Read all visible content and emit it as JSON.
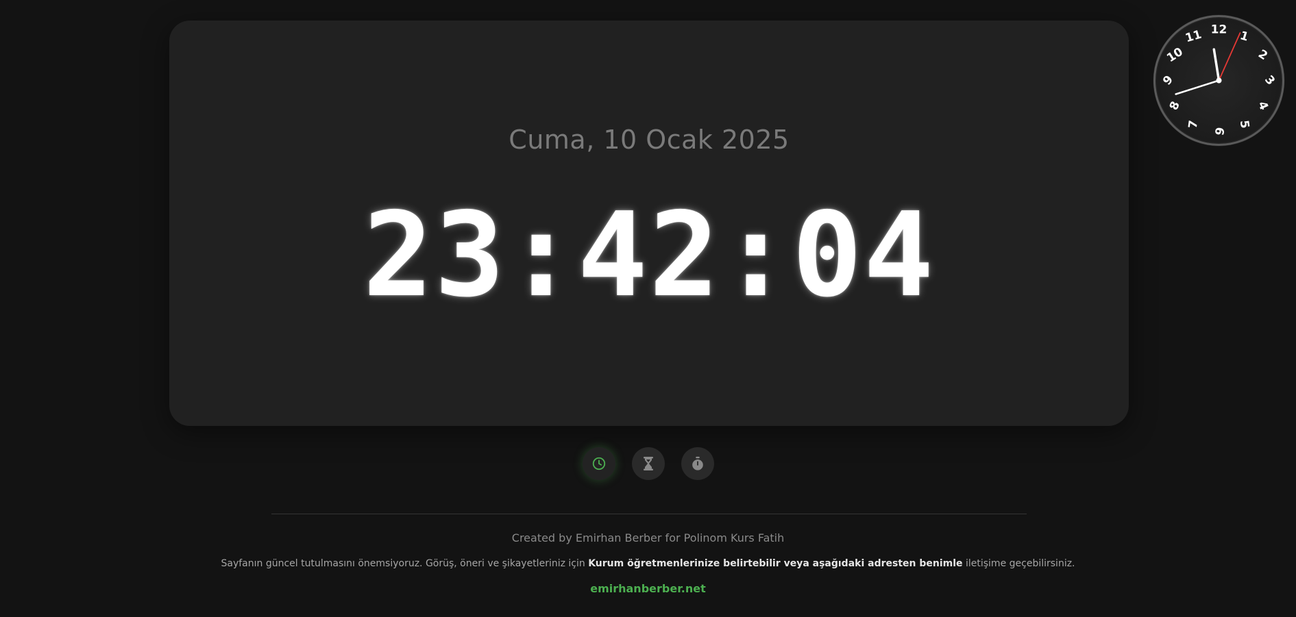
{
  "date_text": "Cuma, 10 Ocak 2025",
  "time_text": "23:42:04",
  "clock_numbers": [
    "12",
    "1",
    "2",
    "3",
    "4",
    "5",
    "6",
    "7",
    "8",
    "9",
    "10",
    "11"
  ],
  "clock_time": {
    "hours": 23,
    "minutes": 42,
    "seconds": 4
  },
  "mode_buttons": [
    {
      "name": "clock-mode",
      "icon": "clock-icon",
      "active": true
    },
    {
      "name": "timer-mode",
      "icon": "hourglass-icon",
      "active": false
    },
    {
      "name": "stopwatch-mode",
      "icon": "stopwatch-icon",
      "active": false
    }
  ],
  "footer": {
    "credit": "Created by Emirhan Berber for Polinom Kurs Fatih",
    "notice_before": "Sayfanın güncel tutulmasını önemsiyoruz. Görüş, öneri ve şikayetleriniz için ",
    "notice_bold": "Kurum öğretmenlerinize belirtebilir veya aşağıdaki adresten benimle",
    "notice_after": " iletişime geçebilirsiniz.",
    "link": "emirhanberber.net"
  },
  "colors": {
    "accent": "#4caf50",
    "second_hand": "#e53935",
    "background": "#131313",
    "card": "#212121"
  }
}
